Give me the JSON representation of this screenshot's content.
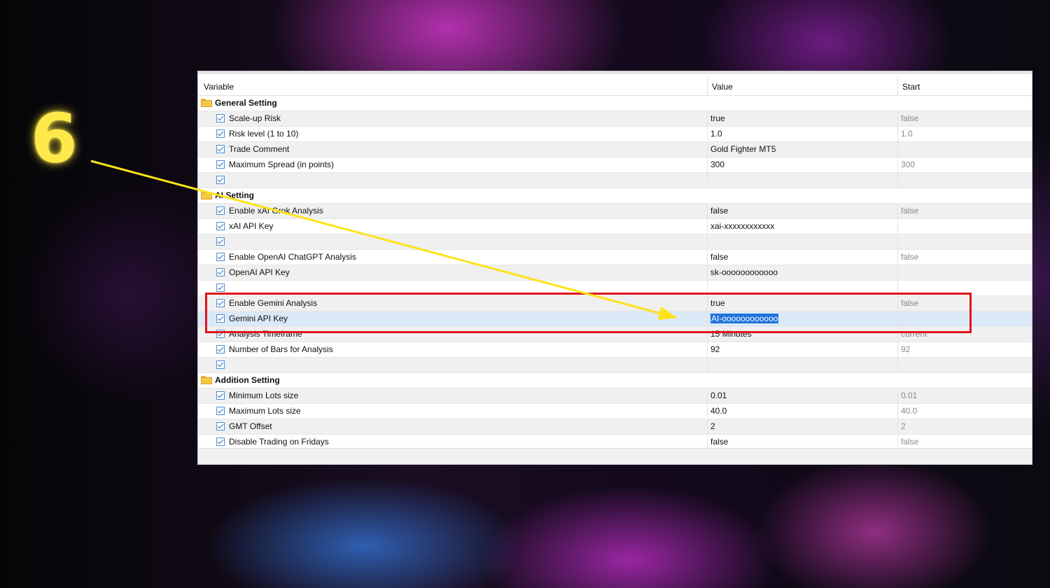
{
  "step_number": "6",
  "colors": {
    "accent": "#ffe94a",
    "highlight": "#e0141c",
    "selection": "#1e73d8"
  },
  "table": {
    "columns": {
      "variable": "Variable",
      "value": "Value",
      "start": "Start"
    },
    "rows": [
      {
        "type": "group",
        "label": "General Setting"
      },
      {
        "type": "param",
        "label": "Scale-up Risk",
        "value": "true",
        "start": "false"
      },
      {
        "type": "param",
        "label": "Risk level (1 to 10)",
        "value": "1.0",
        "start": "1.0"
      },
      {
        "type": "param",
        "label": "Trade Comment",
        "value": "Gold Fighter MT5",
        "start": ""
      },
      {
        "type": "param",
        "label": "Maximum Spread (in points)",
        "value": "300",
        "start": "300"
      },
      {
        "type": "param",
        "label": "",
        "value": "",
        "start": ""
      },
      {
        "type": "group",
        "label": "AI Setting"
      },
      {
        "type": "param",
        "label": "Enable xAI Grok Analysis",
        "value": "false",
        "start": "false"
      },
      {
        "type": "param",
        "label": "xAI API Key",
        "value": "xai-xxxxxxxxxxxx",
        "start": ""
      },
      {
        "type": "param",
        "label": "",
        "value": "",
        "start": ""
      },
      {
        "type": "param",
        "label": "Enable OpenAI ChatGPT Analysis",
        "value": "false",
        "start": "false"
      },
      {
        "type": "param",
        "label": "OpenAI API Key",
        "value": "sk-oooooooooooo",
        "start": ""
      },
      {
        "type": "param",
        "label": "",
        "value": "",
        "start": ""
      },
      {
        "type": "param",
        "label": "Enable Gemini Analysis",
        "value": "true",
        "start": "false"
      },
      {
        "type": "param",
        "label": "Gemini API Key",
        "value": "AI-oooooooooooo",
        "start": "",
        "selected": true
      },
      {
        "type": "param",
        "label": "Analysis Timeframe",
        "value": "15 Minutes",
        "start": "current"
      },
      {
        "type": "param",
        "label": "Number of Bars for Analysis",
        "value": "92",
        "start": "92"
      },
      {
        "type": "param",
        "label": "",
        "value": "",
        "start": ""
      },
      {
        "type": "group",
        "label": "Addition Setting"
      },
      {
        "type": "param",
        "label": "Minimum Lots size",
        "value": "0.01",
        "start": "0.01"
      },
      {
        "type": "param",
        "label": "Maximum Lots size",
        "value": "40.0",
        "start": "40.0"
      },
      {
        "type": "param",
        "label": "GMT Offset",
        "value": "2",
        "start": "2"
      },
      {
        "type": "param",
        "label": "Disable Trading on Fridays",
        "value": "false",
        "start": "false"
      }
    ]
  }
}
